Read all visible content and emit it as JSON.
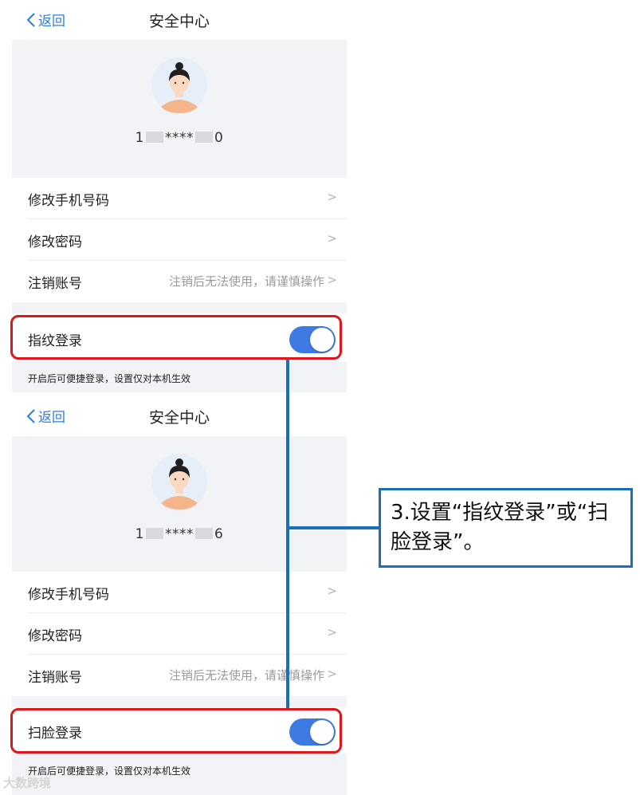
{
  "screens": [
    {
      "nav": {
        "back_label": "返回",
        "title": "安全中心"
      },
      "phone": {
        "prefix": "1",
        "stars": "****",
        "suffix": "0"
      },
      "rows": [
        {
          "label": "修改手机号码",
          "hint": ""
        },
        {
          "label": "修改密码",
          "hint": ""
        },
        {
          "label": "注销账号",
          "hint": "注销后无法使用，请谨慎操作"
        }
      ],
      "toggle_row": {
        "label": "指纹登录",
        "enabled": true
      },
      "footnote": "开启后可便捷登录，设置仅对本机生效"
    },
    {
      "nav": {
        "back_label": "返回",
        "title": "安全中心"
      },
      "phone": {
        "prefix": "1",
        "stars": "****",
        "suffix": "6"
      },
      "rows": [
        {
          "label": "修改手机号码",
          "hint": ""
        },
        {
          "label": "修改密码",
          "hint": ""
        },
        {
          "label": "注销账号",
          "hint": "注销后无法使用，请谨慎操作"
        }
      ],
      "toggle_row": {
        "label": "扫脸登录",
        "enabled": true
      },
      "footnote": "开启后可便捷登录，设置仅对本机生效"
    }
  ],
  "chevron": ">",
  "annotation": {
    "text": "3.设置“指纹登录”或“扫脸登录”。"
  },
  "watermark": "大数跨境",
  "colors": {
    "accent": "#3d7ae2",
    "highlight": "#e0161b",
    "connector": "#1a6fb8",
    "link": "#2f7de1"
  },
  "icons": {
    "back": "chevron-left-icon",
    "avatar": "user-avatar-icon"
  }
}
